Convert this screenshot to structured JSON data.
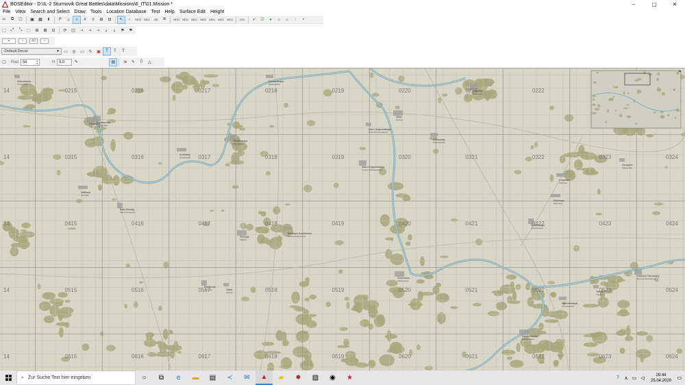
{
  "window": {
    "title": "BOSEditor - D:\\IL-2 Sturmovik Great Battles\\data\\Missions\\6_IT\\01.Mission *",
    "controls": [
      "–",
      "▢",
      "✕"
    ]
  },
  "menu": [
    "File",
    "View",
    "Search and Select",
    "Draw",
    "Tools",
    "Location Database",
    "Test",
    "Help",
    "Surface Edit",
    "Height"
  ],
  "toolbar1": {
    "icons": [
      "cut-icon",
      "copy-icon",
      "delete-icon",
      "group-icon",
      "save-icon",
      "load-icon",
      "import-icon",
      "filter-icon",
      "anchor-icon",
      "select-rect-icon",
      "grid-icon",
      "align-icon",
      "link-icon",
      "unlink-icon",
      "cursor-icon"
    ],
    "labels": [
      "LIB",
      "MCU",
      "MCU",
      "MCU",
      "MCU",
      "MCU",
      "MCU",
      "MCU",
      "LOC"
    ]
  },
  "toolbar4": {
    "decal_select": "-Default Decal-"
  },
  "toolbar5": {
    "rad_label": "Rad",
    "rad_value": "50",
    "h_label": "H",
    "h_value": "5.0"
  },
  "map": {
    "colors": {
      "land": "#d8d6c6",
      "forest": "#a8a77c",
      "river": "#7fa6b5",
      "grid_major": "#9a9a92",
      "grid_minor": "#c4c2b4",
      "town": "#9e9e9e"
    },
    "col_numbers": [
      "14",
      "15",
      "16",
      "17",
      "18",
      "19",
      "20",
      "21",
      "22",
      "23",
      "24"
    ],
    "row_numbers": [
      "02",
      "03",
      "04",
      "05",
      "06"
    ],
    "towns": [
      {
        "name": "Sukhodonka",
        "sub": "Суходонка"
      },
      {
        "name": "Podzharovka",
        "sub": "Подзаровка"
      },
      {
        "name": "Kozlinskiy",
        "sub": "Козлинский"
      },
      {
        "name": "Pershbakaya",
        "sub": "Першбакая"
      },
      {
        "name": "Kremenskaya",
        "sub": "Кременская"
      },
      {
        "name": "Vilkin",
        "sub": "Вилкин"
      },
      {
        "name": "Novo-Grigorevskaya",
        "sub": "Ново-Григорьевская"
      },
      {
        "name": "Staro-Grigorevskaya",
        "sub": "Старо-Григорьевская"
      },
      {
        "name": "Kalibaya",
        "sub": "Калибая"
      },
      {
        "name": "Malo-Klinskiy",
        "sub": "Мало-Клинский"
      },
      {
        "name": "Bolshaya Donshchina",
        "sub": "Большая Донщина"
      },
      {
        "name": "Zimovnikov",
        "sub": "Зимовников"
      },
      {
        "name": "Zatlar",
        "sub": "Затлар"
      },
      {
        "name": "Panshino",
        "sub": "Паньшино"
      },
      {
        "name": "Lobachev",
        "sub": "Лобачев"
      },
      {
        "name": "Sirotinskaya",
        "sub": "Сиротинская"
      },
      {
        "name": "Kachalinskaya",
        "sub": "Качалинская"
      },
      {
        "name": "Dzhalenkevich",
        "sub": "Джаленкевич"
      },
      {
        "name": "Zavarykin",
        "sub": "Заварыкин"
      },
      {
        "name": "Verkhne-Pesnovskiy",
        "sub": "Верхне-Песковский"
      },
      {
        "name": "Kletskaya",
        "sub": "Клетская"
      },
      {
        "name": "Khlebnoye",
        "sub": "Хлебное"
      },
      {
        "name": "Zhirkovskiy",
        "sub": "Жирковский"
      },
      {
        "name": "Zimnyak",
        "sub": "Зимняк"
      },
      {
        "name": "Tishkin",
        "sub": "Тишкин"
      },
      {
        "name": "Karetnikov",
        "sub": "Каретников"
      }
    ]
  },
  "taskbar": {
    "search_placeholder": "Zur Suche Text hier eingeben",
    "time": "20:44",
    "date": "25.04.2020",
    "apps": [
      "task-view-icon",
      "edge-icon",
      "file-explorer-icon",
      "store-icon",
      "vscode-icon",
      "mail-icon",
      "il2-editor-icon",
      "sticky-notes-icon",
      "il2-icon",
      "photos-icon",
      "media-icon",
      "game-icon"
    ]
  }
}
